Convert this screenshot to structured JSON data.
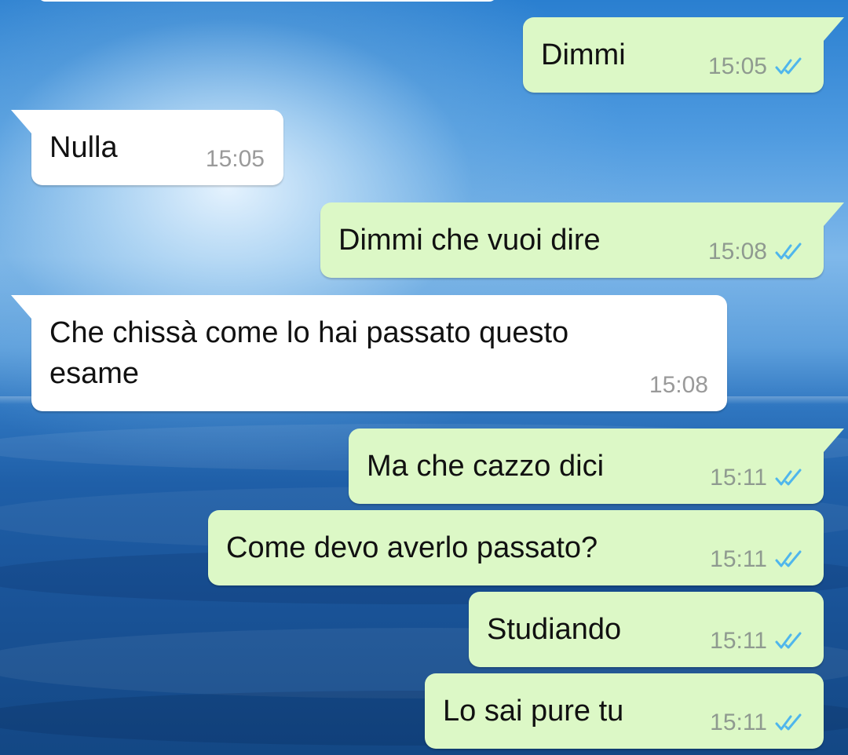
{
  "messages": [
    {
      "direction": "out",
      "text": "Dimmi",
      "time": "15:05",
      "status": "read"
    },
    {
      "direction": "in",
      "text": "Nulla",
      "time": "15:05"
    },
    {
      "direction": "out",
      "text": "Dimmi che vuoi dire",
      "time": "15:08",
      "status": "read"
    },
    {
      "direction": "in",
      "text": "Che chissà come lo hai passato questo\nesame",
      "time": "15:08"
    },
    {
      "direction": "out",
      "text": "Ma che cazzo dici",
      "time": "15:11",
      "status": "read"
    },
    {
      "direction": "out",
      "text": "Come devo averlo passato?",
      "time": "15:11",
      "status": "read"
    },
    {
      "direction": "out",
      "text": "Studiando",
      "time": "15:11",
      "status": "read"
    },
    {
      "direction": "out",
      "text": "Lo sai pure tu",
      "time": "15:11",
      "status": "read"
    }
  ],
  "icons": {
    "read_receipt": "double-check-icon"
  },
  "colors": {
    "outgoing_bubble": "#dcf8c6",
    "incoming_bubble": "#ffffff",
    "read_ticks": "#4fb6ec",
    "timestamp": "#8f9a90"
  }
}
